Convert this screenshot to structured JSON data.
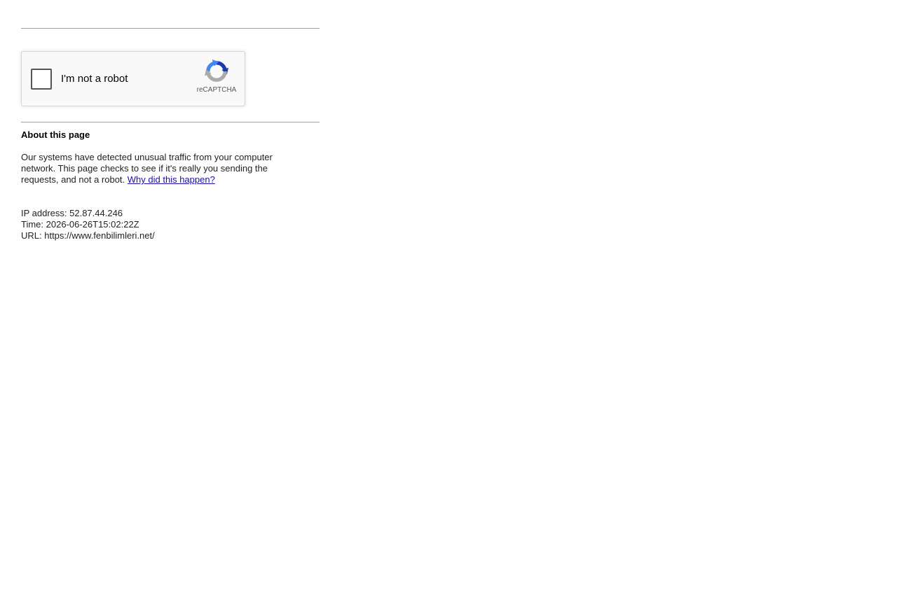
{
  "captcha": {
    "label": "I'm not a robot",
    "brand": "reCAPTCHA",
    "checked": false,
    "colors": {
      "arrow_blue": "#1c3aa9",
      "arrow_light_blue": "#4285f4",
      "arrow_gray": "#ababab"
    }
  },
  "about": {
    "title": "About this page",
    "text": "Our systems have detected unusual traffic from your computer network. This page checks to see if it's really you sending the requests, and not a robot.",
    "link_label": "Why did this happen?"
  },
  "info": {
    "ip": "IP address: 52.87.44.246",
    "time": "Time: 2026-06-26T15:02:22Z",
    "url": "URL: https://www.fenbilimleri.net/"
  },
  "colors": {
    "link": "#1a0dab",
    "rule": "#9e9e9e",
    "text": "#222222"
  }
}
